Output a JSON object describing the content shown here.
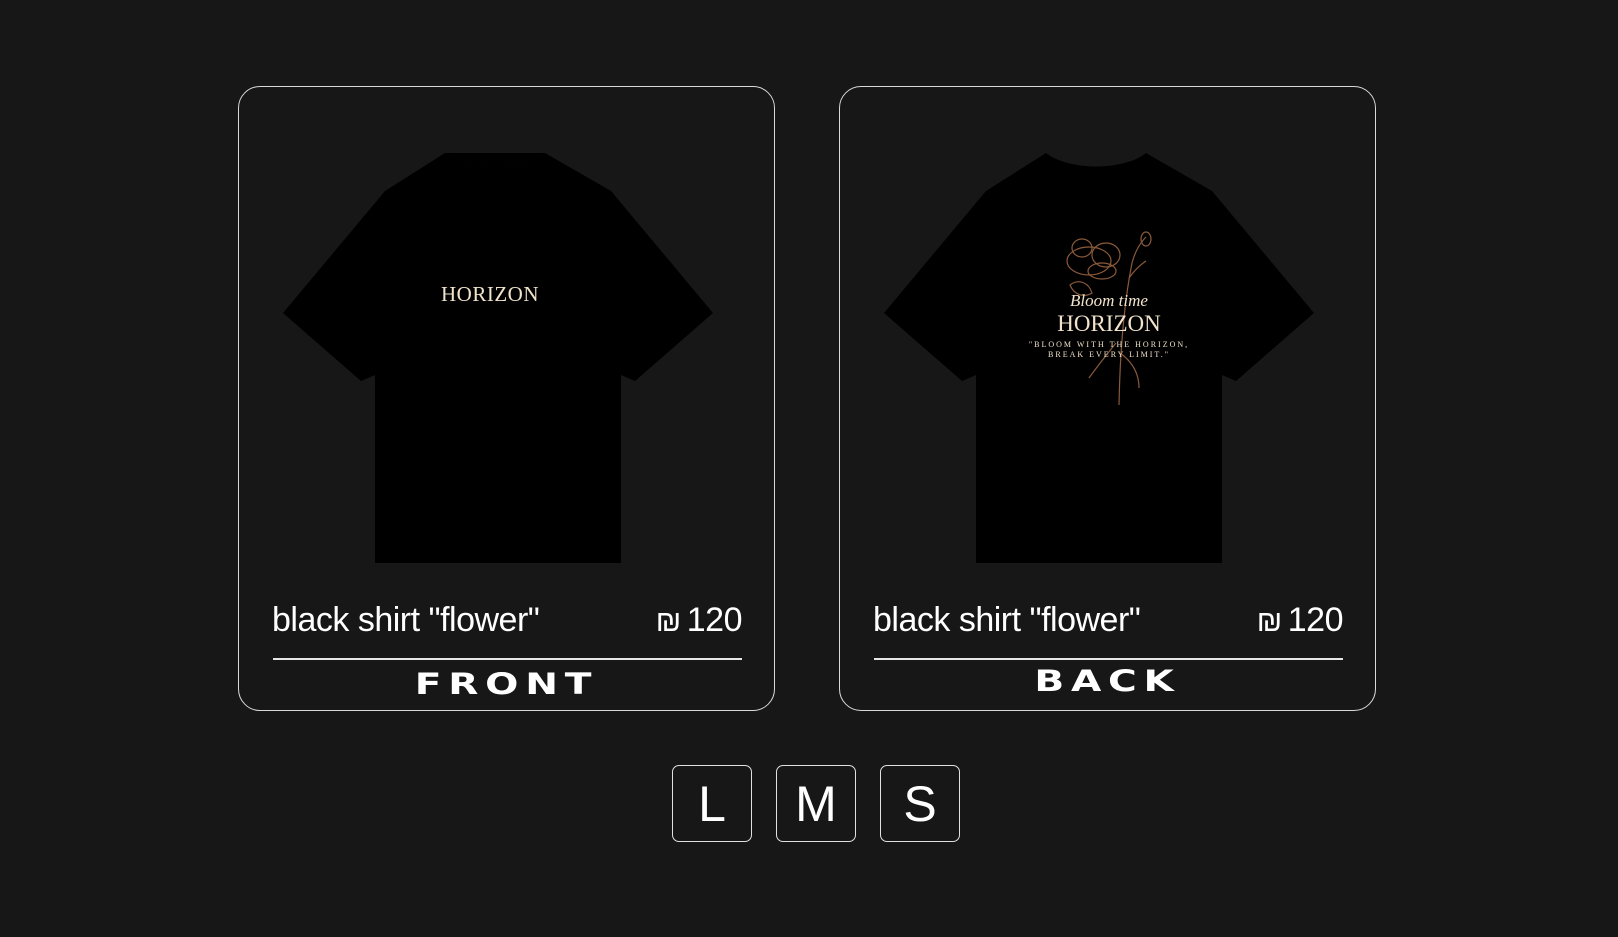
{
  "products": [
    {
      "name": "black shirt \"flower\"",
      "currency": "₪",
      "price": "120",
      "side": "FRONT",
      "print_text": "HORIZON"
    },
    {
      "name": "black shirt \"flower\"",
      "currency": "₪",
      "price": "120",
      "side": "BACK",
      "print_script": "Bloom time",
      "print_text": "HORIZON",
      "print_quote_1": "\"BLOOM WITH THE HORIZON,",
      "print_quote_2": "BREAK EVERY LIMIT.\""
    }
  ],
  "sizes": [
    "L",
    "M",
    "S"
  ],
  "colors": {
    "background": "#171717",
    "shirt": "#000000",
    "print": "#f1e3cc",
    "flower_outline": "#8a5a3a"
  }
}
